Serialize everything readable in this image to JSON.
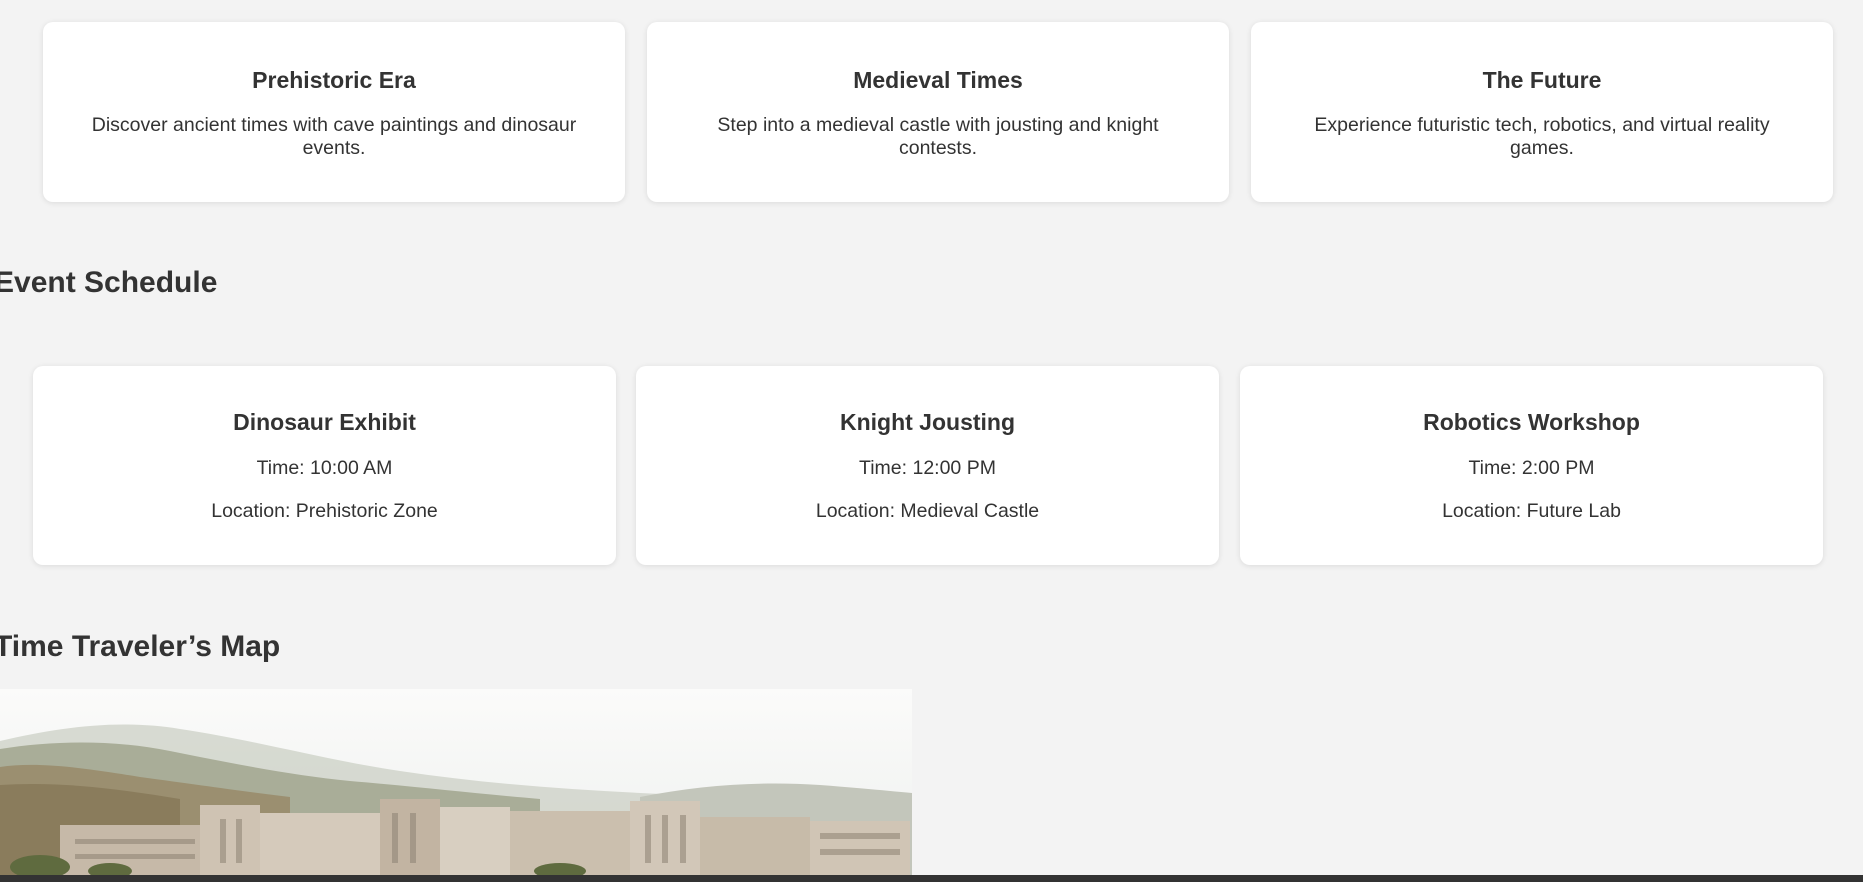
{
  "eras": [
    {
      "title": "Prehistoric Era",
      "description": "Discover ancient times with cave paintings and dinosaur events."
    },
    {
      "title": "Medieval Times",
      "description": "Step into a medieval castle with jousting and knight contests."
    },
    {
      "title": "The Future",
      "description": "Experience futuristic tech, robotics, and virtual reality games."
    }
  ],
  "schedule": {
    "heading": "Event Schedule",
    "events": [
      {
        "title": "Dinosaur Exhibit",
        "time": "Time: 10:00 AM",
        "location": "Location: Prehistoric Zone"
      },
      {
        "title": "Knight Jousting",
        "time": "Time: 12:00 PM",
        "location": "Location: Medieval Castle"
      },
      {
        "title": "Robotics Workshop",
        "time": "Time: 2:00 PM",
        "location": "Location: Future Lab"
      }
    ]
  },
  "map": {
    "heading": "Time Traveler’s Map"
  },
  "colors": {
    "background": "#f3f3f3",
    "card": "#ffffff",
    "text": "#333333",
    "footer_bar": "#333333"
  }
}
